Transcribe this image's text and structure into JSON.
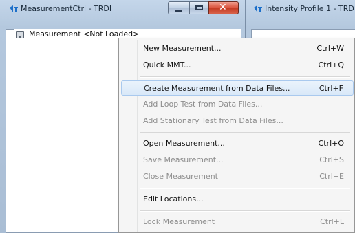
{
  "left_window": {
    "title": "MeasurementCtrl - TRDI",
    "close_glyph": "✕",
    "tree_item": "Measurement <Not Loaded>"
  },
  "right_window": {
    "title": "Intensity Profile 1 - TRD"
  },
  "icons": {
    "app": "trdi-logo-icon",
    "tree": "measurement-icon"
  },
  "colors": {
    "highlight_border": "#a9c9ee",
    "disabled_text": "#8d8d8d",
    "close_button": "#c43a22"
  },
  "context_menu": {
    "items": [
      {
        "label": "New Measurement...",
        "shortcut": "Ctrl+W",
        "enabled": true
      },
      {
        "label": "Quick MMT...",
        "shortcut": "Ctrl+Q",
        "enabled": true
      },
      {
        "label": "Create Measurement from Data Files...",
        "shortcut": "Ctrl+F",
        "enabled": true,
        "highlighted": true
      },
      {
        "label": "Add Loop Test from Data Files...",
        "shortcut": "",
        "enabled": false
      },
      {
        "label": "Add Stationary Test from Data Files...",
        "shortcut": "",
        "enabled": false
      },
      {
        "label": "Open Measurement...",
        "shortcut": "Ctrl+O",
        "enabled": true
      },
      {
        "label": "Save Measurement...",
        "shortcut": "Ctrl+S",
        "enabled": false
      },
      {
        "label": "Close Measurement",
        "shortcut": "Ctrl+E",
        "enabled": false
      },
      {
        "label": "Edit Locations...",
        "shortcut": "",
        "enabled": true
      },
      {
        "label": "Lock Measurement",
        "shortcut": "Ctrl+L",
        "enabled": false
      }
    ]
  }
}
